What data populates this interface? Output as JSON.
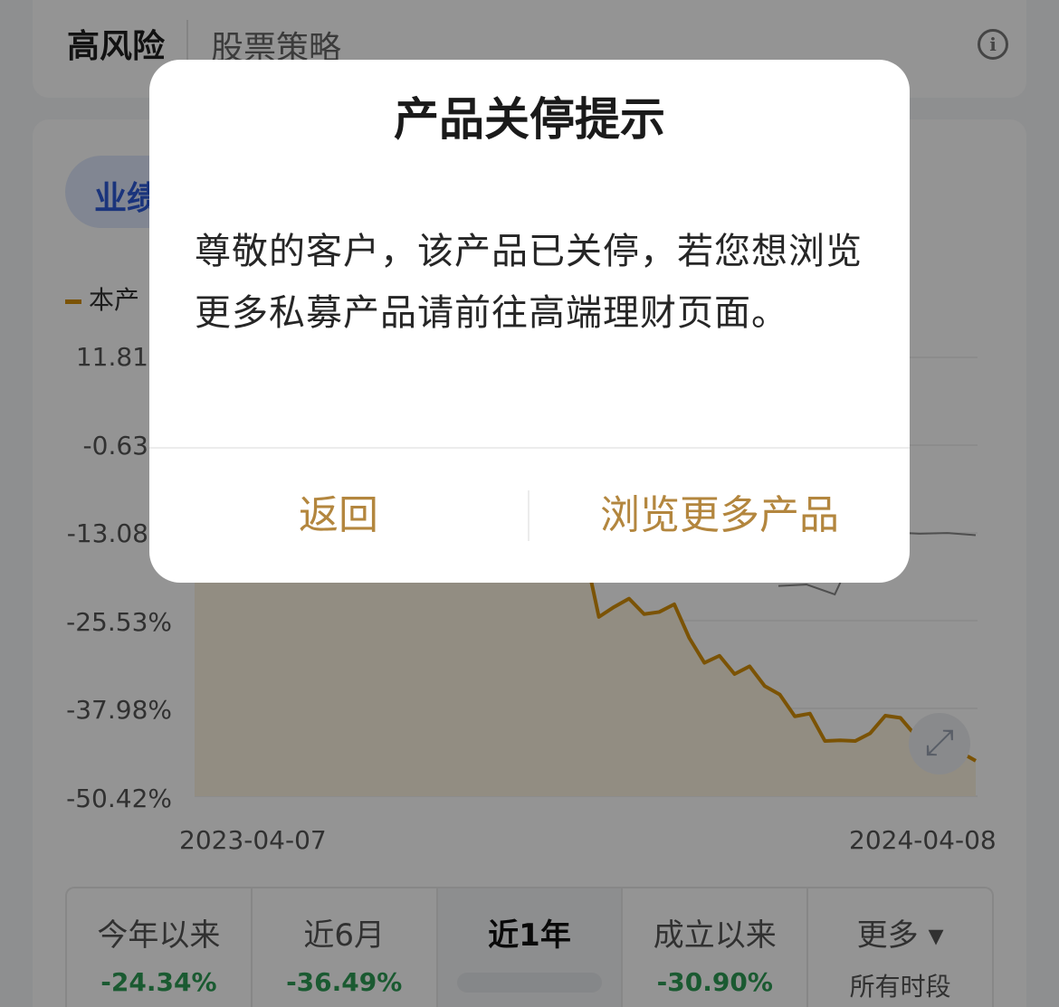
{
  "header": {
    "risk_level": "高风险",
    "strategy": "股票策略",
    "info_icon": "info-icon"
  },
  "performance_tab": "业绩",
  "legend_label": "本产",
  "y_axis": [
    "11.81",
    "-0.63",
    "-13.08",
    "-25.53%",
    "-37.98%",
    "-50.42%"
  ],
  "x_axis": [
    "2023-04-07",
    "2024-04-08"
  ],
  "chart_data": {
    "type": "line",
    "x_range": [
      "2023-04-07",
      "2024-04-08"
    ],
    "ylim": [
      -50.42,
      11.81
    ],
    "series": [
      {
        "name": "",
        "color": "#d4900a",
        "visible_values": [
          -15.0,
          -25.0,
          -23.6,
          -22.4,
          -24.6,
          -24.3,
          -23.2,
          -28.0,
          -31.5,
          -30.5,
          -33.1,
          -32.0,
          -34.8,
          -36.0,
          -39.1,
          -38.7,
          -42.6,
          -42.5,
          -42.6,
          -41.5,
          -39.0,
          -39.3,
          -41.8,
          -42.0,
          -40.2,
          -44.2,
          -45.4
        ],
        "fill": "#fcf3e0"
      },
      {
        "name": "",
        "color": "#888888",
        "visible_values": [
          -20.6,
          -20.4,
          -21.8,
          -13.2,
          -13.0,
          -13.2,
          -13.1,
          -13.4
        ]
      }
    ],
    "grid": true
  },
  "expand_icon": "expand-icon",
  "periods": [
    {
      "name": "今年以来",
      "value": "-24.34%"
    },
    {
      "name": "近6月",
      "value": "-36.49%"
    },
    {
      "name": "近1年",
      "value": ""
    },
    {
      "name": "成立以来",
      "value": "-30.90%"
    },
    {
      "name": "更多 ▾",
      "value": "所有时段"
    }
  ],
  "modal": {
    "title": "产品关停提示",
    "body": "尊敬的客户，该产品已关停，若您想浏览更多私募产品请前往高端理财页面。",
    "back_label": "返回",
    "browse_label": "浏览更多产品",
    "accent_color": "#b3863e"
  }
}
